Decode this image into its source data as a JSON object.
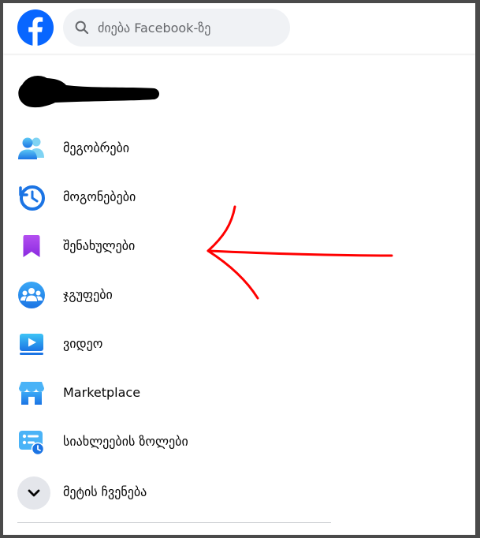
{
  "header": {
    "logo_icon": "facebook-logo-icon",
    "search": {
      "icon": "search-icon",
      "placeholder": "ძიება Facebook-ზე"
    }
  },
  "profile": {
    "name_redacted": true
  },
  "menu": {
    "items": [
      {
        "label": "მეგობრები",
        "icon": "friends-icon"
      },
      {
        "label": "მოგონებები",
        "icon": "memories-icon"
      },
      {
        "label": "შენახულები",
        "icon": "saved-icon"
      },
      {
        "label": "ჯგუფები",
        "icon": "groups-icon"
      },
      {
        "label": "ვიდეო",
        "icon": "video-icon"
      },
      {
        "label": "Marketplace",
        "icon": "marketplace-icon"
      },
      {
        "label": "სიახლეების ზოლები",
        "icon": "feeds-icon"
      },
      {
        "label": "მეტის ჩვენება",
        "icon": "chevron-down-icon"
      }
    ]
  },
  "annotation": {
    "type": "red-hand-drawn-arrow",
    "points_to": "შენახულები",
    "color": "#ff0000"
  },
  "colors": {
    "brand": "#0866ff",
    "search_bg": "#f0f2f5",
    "text": "#050505",
    "secondary_text": "#65676b"
  }
}
